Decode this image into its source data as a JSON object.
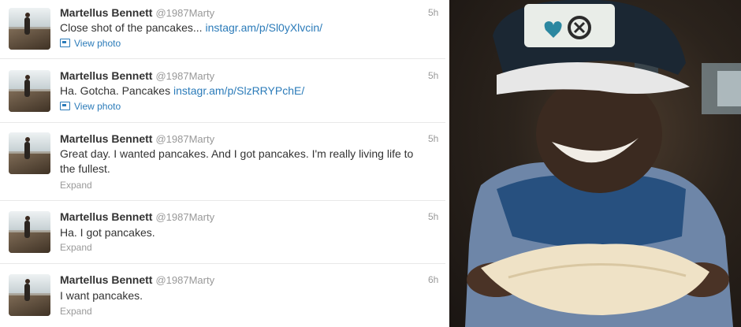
{
  "tweets": [
    {
      "name": "Martellus Bennett",
      "handle": "@1987Marty",
      "time": "5h",
      "text": "Close shot of the pancakes... ",
      "link": "instagr.am/p/Sl0yXlvcin/",
      "meta": "View photo"
    },
    {
      "name": "Martellus Bennett",
      "handle": "@1987Marty",
      "time": "5h",
      "text": "Ha. Gotcha. Pancakes ",
      "link": "instagr.am/p/SlzRRYPchE/",
      "meta": "View photo"
    },
    {
      "name": "Martellus Bennett",
      "handle": "@1987Marty",
      "time": "5h",
      "text": "Great day. I wanted pancakes. And I got pancakes. I'm really living life to the fullest.",
      "link": "",
      "meta": "Expand"
    },
    {
      "name": "Martellus Bennett",
      "handle": "@1987Marty",
      "time": "5h",
      "text": "Ha. I got pancakes.",
      "link": "",
      "meta": "Expand"
    },
    {
      "name": "Martellus Bennett",
      "handle": "@1987Marty",
      "time": "6h",
      "text": "I want pancakes.",
      "link": "",
      "meta": "Expand"
    }
  ],
  "colors": {
    "link": "#2b7bb9",
    "text": "#333333",
    "muted": "#999999"
  },
  "icons": {
    "view_photo": "photo-icon"
  }
}
